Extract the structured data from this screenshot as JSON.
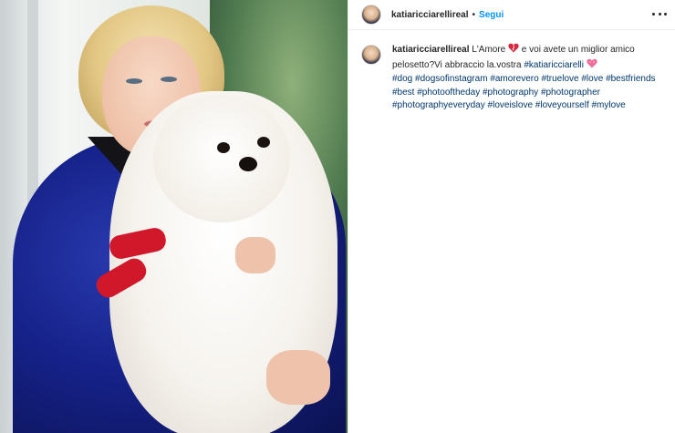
{
  "post": {
    "username": "katiaricciarellireal",
    "separator": "•",
    "follow_label": "Segui",
    "more_icon": "more-horizontal-icon"
  },
  "caption": {
    "username": "katiaricciarellireal",
    "text_part1": "L'Amore",
    "emoji1": "heart-emoji",
    "text_part2": " e voi avete un miglior amico pelosetto?Vi abbraccio la.vostra",
    "mention": "#katiaricciarelli",
    "emoji2": "pink-heart-emoji",
    "hashtags": [
      "#dog",
      "#dogsofinstagram",
      "#amorevero",
      "#truelove",
      "#love",
      "#bestfriends",
      "#best",
      "#photooftheday",
      "#photography",
      "#photographer",
      "#photographyeveryday",
      "#loveislove",
      "#loveyourself",
      "#mylove"
    ]
  },
  "colors": {
    "link_blue": "#0095f6",
    "hashtag": "#00376b",
    "text": "#262626",
    "divider": "#efefef"
  }
}
